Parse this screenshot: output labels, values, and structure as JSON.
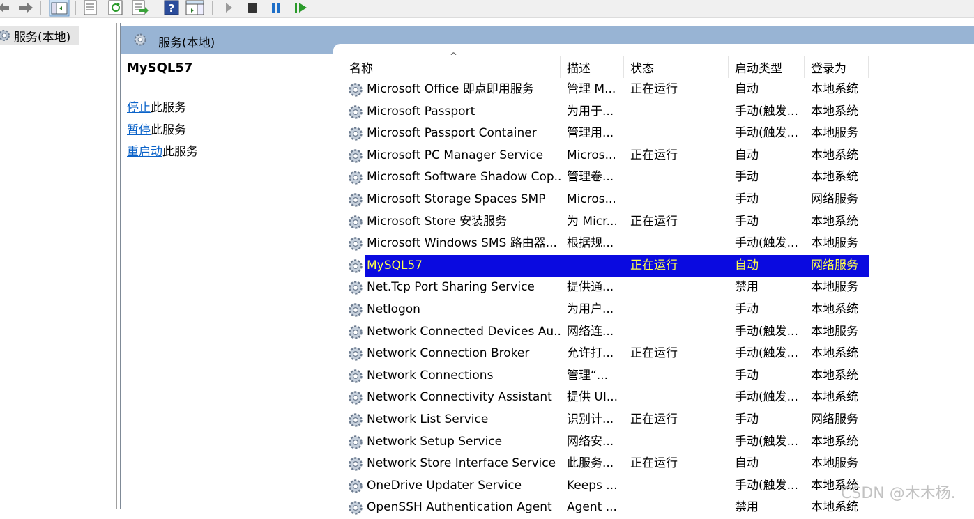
{
  "toolbar": {
    "buttons": [
      "back-arrow-icon",
      "forward-arrow-icon",
      "show-hide-tree-icon",
      "properties-icon",
      "refresh-icon",
      "export-list-icon",
      "help-icon",
      "action-pane-icon",
      "start-service-icon",
      "stop-service-icon",
      "pause-service-icon",
      "resume-service-icon"
    ]
  },
  "tree": {
    "item_label": "服务(本地)"
  },
  "panel": {
    "title": "服务(本地)"
  },
  "extended": {
    "service_name": "MySQL57",
    "actions": [
      {
        "link": "停止",
        "suffix": "此服务"
      },
      {
        "link": "暂停",
        "suffix": "此服务"
      },
      {
        "link": "重启动",
        "suffix": "此服务"
      }
    ]
  },
  "list": {
    "columns": [
      "名称",
      "描述",
      "状态",
      "启动类型",
      "登录为"
    ],
    "rows": [
      {
        "name": "Microsoft Office 即点即用服务",
        "desc": "管理 M...",
        "status": "正在运行",
        "startup": "自动",
        "logon": "本地系统"
      },
      {
        "name": "Microsoft Passport",
        "desc": "为用于...",
        "status": "",
        "startup": "手动(触发...",
        "logon": "本地系统"
      },
      {
        "name": "Microsoft Passport Container",
        "desc": "管理用...",
        "status": "",
        "startup": "手动(触发...",
        "logon": "本地服务"
      },
      {
        "name": "Microsoft PC Manager Service",
        "desc": "Micros...",
        "status": "正在运行",
        "startup": "自动",
        "logon": "本地系统"
      },
      {
        "name": "Microsoft Software Shadow Cop...",
        "desc": "管理卷...",
        "status": "",
        "startup": "手动",
        "logon": "本地系统"
      },
      {
        "name": "Microsoft Storage Spaces SMP",
        "desc": "Micros...",
        "status": "",
        "startup": "手动",
        "logon": "网络服务"
      },
      {
        "name": "Microsoft Store 安装服务",
        "desc": "为 Micr...",
        "status": "正在运行",
        "startup": "手动",
        "logon": "本地系统"
      },
      {
        "name": "Microsoft Windows SMS 路由器...",
        "desc": "根据规...",
        "status": "",
        "startup": "手动(触发...",
        "logon": "本地服务"
      },
      {
        "name": "MySQL57",
        "desc": "",
        "status": "正在运行",
        "startup": "自动",
        "logon": "网络服务",
        "selected": true
      },
      {
        "name": "Net.Tcp Port Sharing Service",
        "desc": "提供通...",
        "status": "",
        "startup": "禁用",
        "logon": "本地服务"
      },
      {
        "name": "Netlogon",
        "desc": "为用户...",
        "status": "",
        "startup": "手动",
        "logon": "本地系统"
      },
      {
        "name": "Network Connected Devices Au...",
        "desc": "网络连...",
        "status": "",
        "startup": "手动(触发...",
        "logon": "本地服务"
      },
      {
        "name": "Network Connection Broker",
        "desc": "允许打...",
        "status": "正在运行",
        "startup": "手动(触发...",
        "logon": "本地系统"
      },
      {
        "name": "Network Connections",
        "desc": "管理“...",
        "status": "",
        "startup": "手动",
        "logon": "本地系统"
      },
      {
        "name": "Network Connectivity Assistant",
        "desc": "提供 UI...",
        "status": "",
        "startup": "手动(触发...",
        "logon": "本地系统"
      },
      {
        "name": "Network List Service",
        "desc": "识别计...",
        "status": "正在运行",
        "startup": "手动",
        "logon": "网络服务"
      },
      {
        "name": "Network Setup Service",
        "desc": "网络安...",
        "status": "",
        "startup": "手动(触发...",
        "logon": "本地系统"
      },
      {
        "name": "Network Store Interface Service",
        "desc": "此服务...",
        "status": "正在运行",
        "startup": "自动",
        "logon": "本地服务"
      },
      {
        "name": "OneDrive Updater Service",
        "desc": "Keeps ...",
        "status": "",
        "startup": "手动(触发...",
        "logon": "本地系统"
      },
      {
        "name": "OpenSSH Authentication Agent",
        "desc": "Agent ...",
        "status": "",
        "startup": "禁用",
        "logon": "本地系统"
      }
    ],
    "selected_color": "#0a0ae0",
    "selected_text_color": "#ffff4a"
  },
  "watermark": "CSDN @木木杨."
}
